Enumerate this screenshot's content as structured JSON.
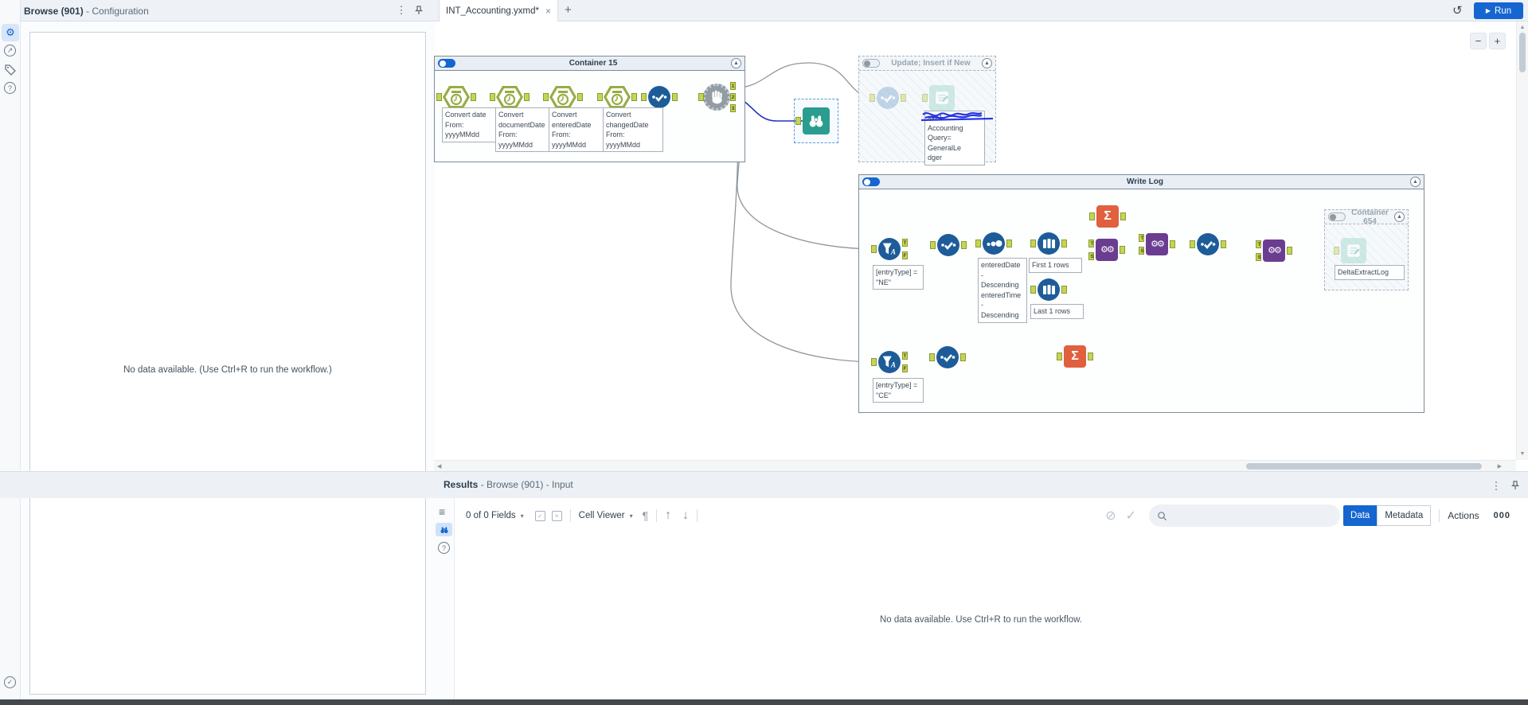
{
  "icons": {
    "kebab": "⋮",
    "close": "×",
    "new_tab": "+",
    "run_play": "▶",
    "history": "↺",
    "zoom_out": "−",
    "zoom_in": "+",
    "scroll_up": "▲",
    "scroll_down": "▼",
    "scroll_left": "◀",
    "scroll_right": "▶",
    "caret_down": "▾",
    "pilcrow": "¶",
    "arrow_up": "↑",
    "arrow_down": "↓",
    "list": "≡",
    "help": "?",
    "gear": "⚙",
    "external_arrow": "↗",
    "no_apply": "⊘",
    "apply_check": "✓",
    "check": "✓",
    "cross": "×",
    "collapse_up": "▲",
    "sigma": "Σ"
  },
  "colors": {
    "accent_blue": "#1566d0",
    "tool_blue": "#1d5c99",
    "tool_orange": "#e0603f",
    "tool_purple": "#6a3d91",
    "tool_green": "#96ad43",
    "tool_teal": "#2a9d8f",
    "wire_selected": "#2430c8"
  },
  "config_panel": {
    "title": "Browse (901)",
    "subtitle": " - Configuration",
    "empty_message": "No data available. (Use Ctrl+R to run the workflow.)"
  },
  "tab_bar": {
    "active_tab": "INT_Accounting.yxmd*",
    "run_label": "Run"
  },
  "canvas": {
    "containers": {
      "c15": {
        "title": "Container 15"
      },
      "update": {
        "title": "Update; Insert if New"
      },
      "writelog": {
        "title": "Write Log"
      },
      "c654": {
        "title": "Container 654"
      }
    },
    "annotations": {
      "convert_date": "Convert date\nFrom:\nyyyyMMdd",
      "convert_document_date": "Convert\ndocumentDate\nFrom:\nyyyyMMdd",
      "convert_entered_date": "Convert\nenteredDate\nFrom:\nyyyyMMdd",
      "convert_changed_date": "Convert\nchangedDate\nFrom:\nyyyyMMdd",
      "update_output": "akc1\nAccounting\nQuery= GeneralLe\ndger",
      "filter_ne": "[entryType] =\n\"NE\"",
      "sort": "enteredDate -\nDescending\nenteredTime -\nDescending",
      "sample_first": "First 1 rows",
      "sample_last": "Last 1 rows",
      "delta_log": "DeltaExtractLog",
      "filter_ce": "[entryType] =\n\"CE\""
    },
    "anchor_labels": {
      "t": "T",
      "f": "F",
      "s": "S",
      "o1": "1",
      "o2": "2",
      "o3": "3"
    }
  },
  "results": {
    "title": "Results",
    "subtitle": " - Browse (901) - Input",
    "toolbar": {
      "fields": "0 of 0 Fields",
      "cell_viewer": "Cell Viewer",
      "data": "Data",
      "metadata": "Metadata",
      "actions": "Actions",
      "actions_count": "000"
    },
    "empty_message": "No data available. Use Ctrl+R to run the workflow."
  }
}
